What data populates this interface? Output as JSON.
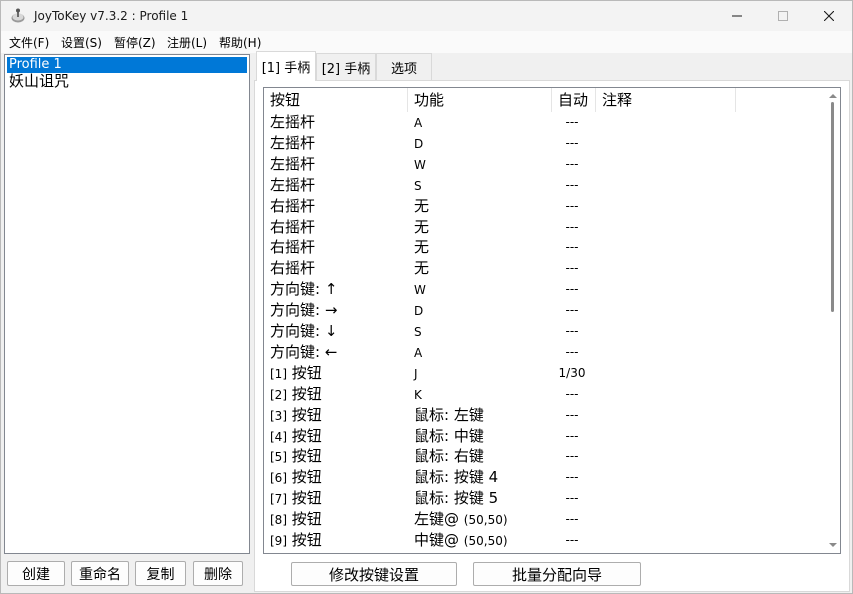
{
  "window": {
    "title": "JoyToKey v7.3.2 : Profile 1"
  },
  "menu": [
    "文件(F)",
    "设置(S)",
    "暂停(Z)",
    "注册(L)",
    "帮助(H)"
  ],
  "profiles": [
    "Profile 1",
    "妖山诅咒"
  ],
  "left_buttons": [
    "创建",
    "重命名",
    "复制",
    "删除"
  ],
  "tabs": [
    "[1] 手柄",
    "[2] 手柄",
    "选项"
  ],
  "columns": [
    "按钮",
    "功能",
    "自动",
    "注释"
  ],
  "rows": [
    {
      "btn": "左摇杆",
      "fn": "A",
      "auto": "---"
    },
    {
      "btn": "左摇杆",
      "fn": "D",
      "auto": "---"
    },
    {
      "btn": "左摇杆",
      "fn": "W",
      "auto": "---"
    },
    {
      "btn": "左摇杆",
      "fn": "S",
      "auto": "---"
    },
    {
      "btn": "右摇杆",
      "fn": "无",
      "auto": "---"
    },
    {
      "btn": "右摇杆",
      "fn": "无",
      "auto": "---"
    },
    {
      "btn": "右摇杆",
      "fn": "无",
      "auto": "---"
    },
    {
      "btn": "右摇杆",
      "fn": "无",
      "auto": "---"
    },
    {
      "btn": "方向键: ↑",
      "fn": "W",
      "auto": "---"
    },
    {
      "btn": "方向键: →",
      "fn": "D",
      "auto": "---"
    },
    {
      "btn": "方向键: ↓",
      "fn": "S",
      "auto": "---"
    },
    {
      "btn": "方向键: ←",
      "fn": "A",
      "auto": "---"
    },
    {
      "btn_num": "[1]",
      "btn": "按钮",
      "fn": "J",
      "auto": "1/30"
    },
    {
      "btn_num": "[2]",
      "btn": "按钮",
      "fn": "K",
      "auto": "---"
    },
    {
      "btn_num": "[3]",
      "btn": "按钮",
      "fn": "鼠标: 左键",
      "auto": "---"
    },
    {
      "btn_num": "[4]",
      "btn": "按钮",
      "fn": "鼠标: 中键",
      "auto": "---"
    },
    {
      "btn_num": "[5]",
      "btn": "按钮",
      "fn": "鼠标: 右键",
      "auto": "---"
    },
    {
      "btn_num": "[6]",
      "btn": "按钮",
      "fn": "鼠标: 按键 4",
      "auto": "---"
    },
    {
      "btn_num": "[7]",
      "btn": "按钮",
      "fn": "鼠标: 按键 5",
      "auto": "---"
    },
    {
      "btn_num": "[8]",
      "btn": "按钮",
      "fn": "左键@",
      "fn_extra": "(50,50)",
      "auto": "---"
    },
    {
      "btn_num": "[9]",
      "btn": "按钮",
      "fn": "中键@",
      "fn_extra": "(50,50)",
      "auto": "---"
    }
  ],
  "bottom_buttons": [
    "修改按键设置",
    "批量分配向导"
  ]
}
